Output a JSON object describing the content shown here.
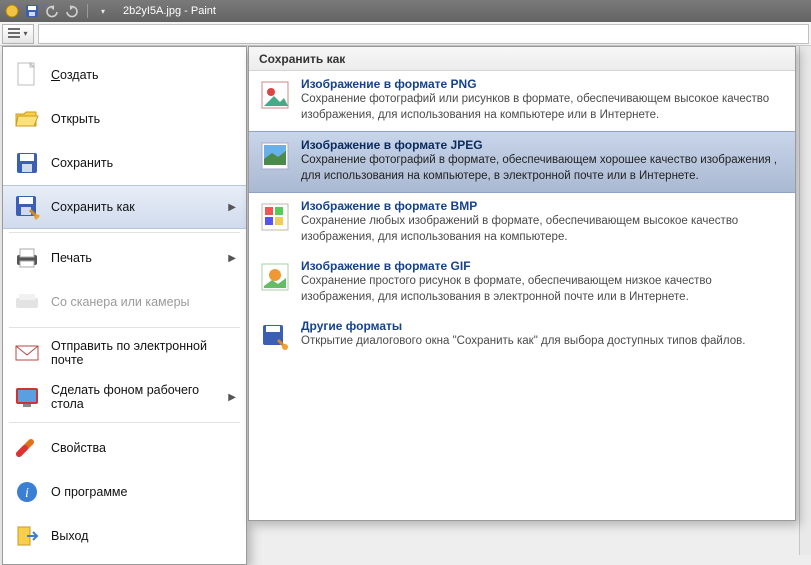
{
  "titlebar": {
    "filename": "2b2yI5A.jpg - Paint"
  },
  "menu": {
    "create": "Создать",
    "open": "Открыть",
    "save": "Сохранить",
    "save_as": "Сохранить как",
    "print": "Печать",
    "scanner": "Со сканера или камеры",
    "email": "Отправить по электронной почте",
    "desktop_bg": "Сделать фоном рабочего стола",
    "properties": "Свойства",
    "about": "О программе",
    "exit": "Выход"
  },
  "submenu": {
    "header": "Сохранить как",
    "items": [
      {
        "title": "Изображение в формате PNG",
        "desc": "Сохранение фотографий или рисунков в формате, обеспечивающем высокое качество изображения, для использования на компьютере или в Интернете."
      },
      {
        "title": "Изображение в формате JPEG",
        "desc": "Сохранение фотографий в формате, обеспечивающем хорошее качество изображения , для использования на компьютере, в электронной почте или в Интернете."
      },
      {
        "title": "Изображение в формате BMP",
        "desc": "Сохранение любых изображений в формате, обеспечивающем высокое качество изображения, для использования на компьютере."
      },
      {
        "title": "Изображение в формате GIF",
        "desc": "Сохранение простого рисунок в формате, обеспечивающем низкое качество изображения, для использования в электронной почте или в Интернете."
      },
      {
        "title": "Другие форматы",
        "desc": "Открытие диалогового окна \"Сохранить как\" для выбора доступных типов файлов."
      }
    ]
  }
}
